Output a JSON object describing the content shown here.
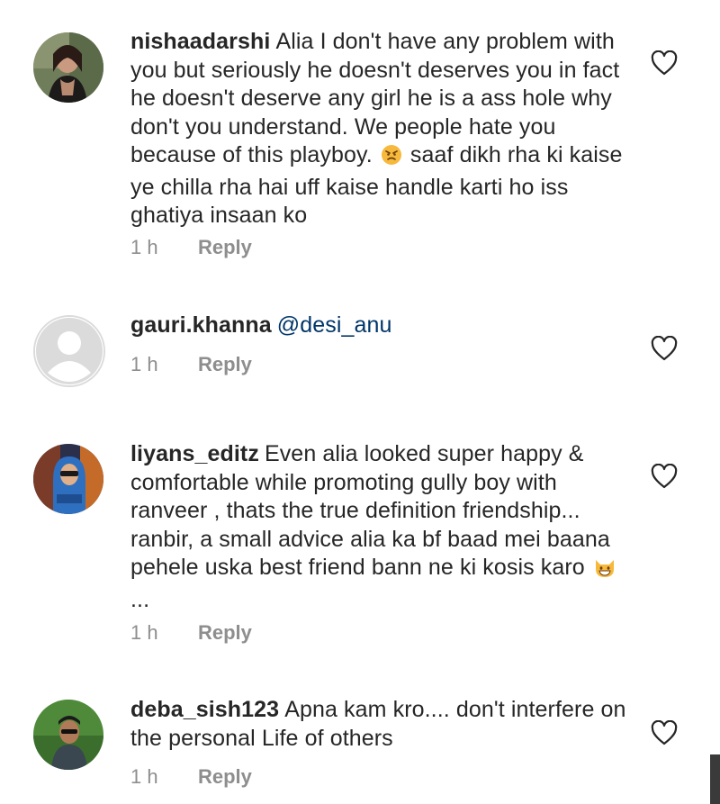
{
  "comments": [
    {
      "username": "nishaadarshi",
      "text_before_emoji": "Alia I don't have any problem with you but seriously he doesn't deserves you in fact he doesn't deserve any girl he is a ass hole why don't you understand. We people hate you because of this playboy.",
      "emoji": "angry-face",
      "text_after_emoji": "saaf dikh rha ki kaise ye chilla rha hai uff kaise handle karti ho iss ghatiya insaan ko",
      "time": "1 h",
      "reply_label": "Reply"
    },
    {
      "username": "gauri.khanna",
      "mention": "@desi_anu",
      "time": "1 h",
      "reply_label": "Reply"
    },
    {
      "username": "liyans_editz",
      "text_before_emoji": "Even alia looked super happy & comfortable while promoting gully boy with ranveer , thats the true definition friendship... ranbir, a small advice alia ka bf baad mei baana pehele uska best friend bann ne ki kosis karo",
      "emoji": "grinning-cat-face",
      "text_after_emoji": "...",
      "time": "1 h",
      "reply_label": "Reply"
    },
    {
      "username": "deba_sish123",
      "text": "Apna kam kro.... don't interfere on the personal Life of others",
      "time": "1 h",
      "reply_label": "Reply"
    }
  ],
  "icons": {
    "like": "heart-outline-icon",
    "default_avatar": "person-silhouette-icon"
  },
  "colors": {
    "text": "#262626",
    "muted": "#8e8e8e",
    "mention": "#003569",
    "placeholder_avatar": "#dbdbdb"
  }
}
